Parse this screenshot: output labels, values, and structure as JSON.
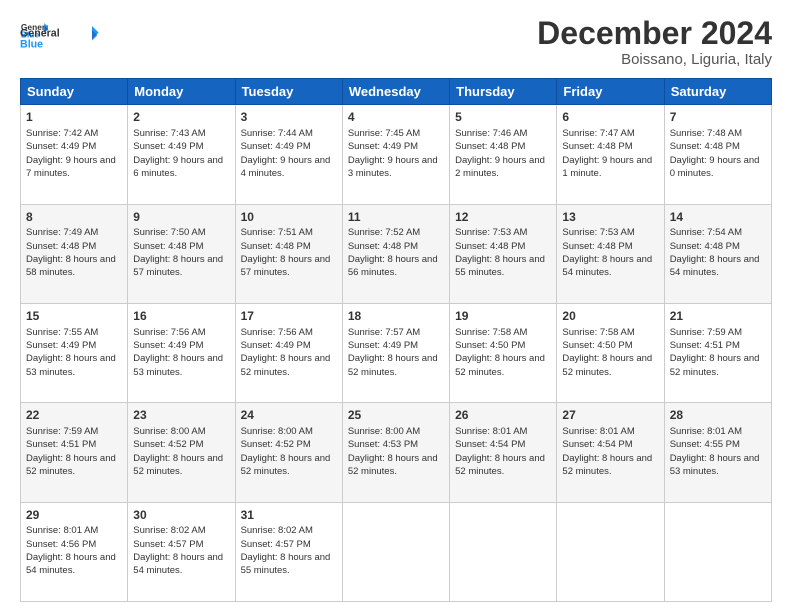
{
  "header": {
    "logo_line1": "General",
    "logo_line2": "Blue",
    "title": "December 2024",
    "subtitle": "Boissano, Liguria, Italy"
  },
  "calendar": {
    "days_of_week": [
      "Sunday",
      "Monday",
      "Tuesday",
      "Wednesday",
      "Thursday",
      "Friday",
      "Saturday"
    ],
    "weeks": [
      [
        {
          "day": "1",
          "sunrise": "Sunrise: 7:42 AM",
          "sunset": "Sunset: 4:49 PM",
          "daylight": "Daylight: 9 hours and 7 minutes."
        },
        {
          "day": "2",
          "sunrise": "Sunrise: 7:43 AM",
          "sunset": "Sunset: 4:49 PM",
          "daylight": "Daylight: 9 hours and 6 minutes."
        },
        {
          "day": "3",
          "sunrise": "Sunrise: 7:44 AM",
          "sunset": "Sunset: 4:49 PM",
          "daylight": "Daylight: 9 hours and 4 minutes."
        },
        {
          "day": "4",
          "sunrise": "Sunrise: 7:45 AM",
          "sunset": "Sunset: 4:49 PM",
          "daylight": "Daylight: 9 hours and 3 minutes."
        },
        {
          "day": "5",
          "sunrise": "Sunrise: 7:46 AM",
          "sunset": "Sunset: 4:48 PM",
          "daylight": "Daylight: 9 hours and 2 minutes."
        },
        {
          "day": "6",
          "sunrise": "Sunrise: 7:47 AM",
          "sunset": "Sunset: 4:48 PM",
          "daylight": "Daylight: 9 hours and 1 minute."
        },
        {
          "day": "7",
          "sunrise": "Sunrise: 7:48 AM",
          "sunset": "Sunset: 4:48 PM",
          "daylight": "Daylight: 9 hours and 0 minutes."
        }
      ],
      [
        {
          "day": "8",
          "sunrise": "Sunrise: 7:49 AM",
          "sunset": "Sunset: 4:48 PM",
          "daylight": "Daylight: 8 hours and 58 minutes."
        },
        {
          "day": "9",
          "sunrise": "Sunrise: 7:50 AM",
          "sunset": "Sunset: 4:48 PM",
          "daylight": "Daylight: 8 hours and 57 minutes."
        },
        {
          "day": "10",
          "sunrise": "Sunrise: 7:51 AM",
          "sunset": "Sunset: 4:48 PM",
          "daylight": "Daylight: 8 hours and 57 minutes."
        },
        {
          "day": "11",
          "sunrise": "Sunrise: 7:52 AM",
          "sunset": "Sunset: 4:48 PM",
          "daylight": "Daylight: 8 hours and 56 minutes."
        },
        {
          "day": "12",
          "sunrise": "Sunrise: 7:53 AM",
          "sunset": "Sunset: 4:48 PM",
          "daylight": "Daylight: 8 hours and 55 minutes."
        },
        {
          "day": "13",
          "sunrise": "Sunrise: 7:53 AM",
          "sunset": "Sunset: 4:48 PM",
          "daylight": "Daylight: 8 hours and 54 minutes."
        },
        {
          "day": "14",
          "sunrise": "Sunrise: 7:54 AM",
          "sunset": "Sunset: 4:48 PM",
          "daylight": "Daylight: 8 hours and 54 minutes."
        }
      ],
      [
        {
          "day": "15",
          "sunrise": "Sunrise: 7:55 AM",
          "sunset": "Sunset: 4:49 PM",
          "daylight": "Daylight: 8 hours and 53 minutes."
        },
        {
          "day": "16",
          "sunrise": "Sunrise: 7:56 AM",
          "sunset": "Sunset: 4:49 PM",
          "daylight": "Daylight: 8 hours and 53 minutes."
        },
        {
          "day": "17",
          "sunrise": "Sunrise: 7:56 AM",
          "sunset": "Sunset: 4:49 PM",
          "daylight": "Daylight: 8 hours and 52 minutes."
        },
        {
          "day": "18",
          "sunrise": "Sunrise: 7:57 AM",
          "sunset": "Sunset: 4:49 PM",
          "daylight": "Daylight: 8 hours and 52 minutes."
        },
        {
          "day": "19",
          "sunrise": "Sunrise: 7:58 AM",
          "sunset": "Sunset: 4:50 PM",
          "daylight": "Daylight: 8 hours and 52 minutes."
        },
        {
          "day": "20",
          "sunrise": "Sunrise: 7:58 AM",
          "sunset": "Sunset: 4:50 PM",
          "daylight": "Daylight: 8 hours and 52 minutes."
        },
        {
          "day": "21",
          "sunrise": "Sunrise: 7:59 AM",
          "sunset": "Sunset: 4:51 PM",
          "daylight": "Daylight: 8 hours and 52 minutes."
        }
      ],
      [
        {
          "day": "22",
          "sunrise": "Sunrise: 7:59 AM",
          "sunset": "Sunset: 4:51 PM",
          "daylight": "Daylight: 8 hours and 52 minutes."
        },
        {
          "day": "23",
          "sunrise": "Sunrise: 8:00 AM",
          "sunset": "Sunset: 4:52 PM",
          "daylight": "Daylight: 8 hours and 52 minutes."
        },
        {
          "day": "24",
          "sunrise": "Sunrise: 8:00 AM",
          "sunset": "Sunset: 4:52 PM",
          "daylight": "Daylight: 8 hours and 52 minutes."
        },
        {
          "day": "25",
          "sunrise": "Sunrise: 8:00 AM",
          "sunset": "Sunset: 4:53 PM",
          "daylight": "Daylight: 8 hours and 52 minutes."
        },
        {
          "day": "26",
          "sunrise": "Sunrise: 8:01 AM",
          "sunset": "Sunset: 4:54 PM",
          "daylight": "Daylight: 8 hours and 52 minutes."
        },
        {
          "day": "27",
          "sunrise": "Sunrise: 8:01 AM",
          "sunset": "Sunset: 4:54 PM",
          "daylight": "Daylight: 8 hours and 52 minutes."
        },
        {
          "day": "28",
          "sunrise": "Sunrise: 8:01 AM",
          "sunset": "Sunset: 4:55 PM",
          "daylight": "Daylight: 8 hours and 53 minutes."
        }
      ],
      [
        {
          "day": "29",
          "sunrise": "Sunrise: 8:01 AM",
          "sunset": "Sunset: 4:56 PM",
          "daylight": "Daylight: 8 hours and 54 minutes."
        },
        {
          "day": "30",
          "sunrise": "Sunrise: 8:02 AM",
          "sunset": "Sunset: 4:57 PM",
          "daylight": "Daylight: 8 hours and 54 minutes."
        },
        {
          "day": "31",
          "sunrise": "Sunrise: 8:02 AM",
          "sunset": "Sunset: 4:57 PM",
          "daylight": "Daylight: 8 hours and 55 minutes."
        },
        {
          "day": "",
          "sunrise": "",
          "sunset": "",
          "daylight": ""
        },
        {
          "day": "",
          "sunrise": "",
          "sunset": "",
          "daylight": ""
        },
        {
          "day": "",
          "sunrise": "",
          "sunset": "",
          "daylight": ""
        },
        {
          "day": "",
          "sunrise": "",
          "sunset": "",
          "daylight": ""
        }
      ]
    ]
  }
}
